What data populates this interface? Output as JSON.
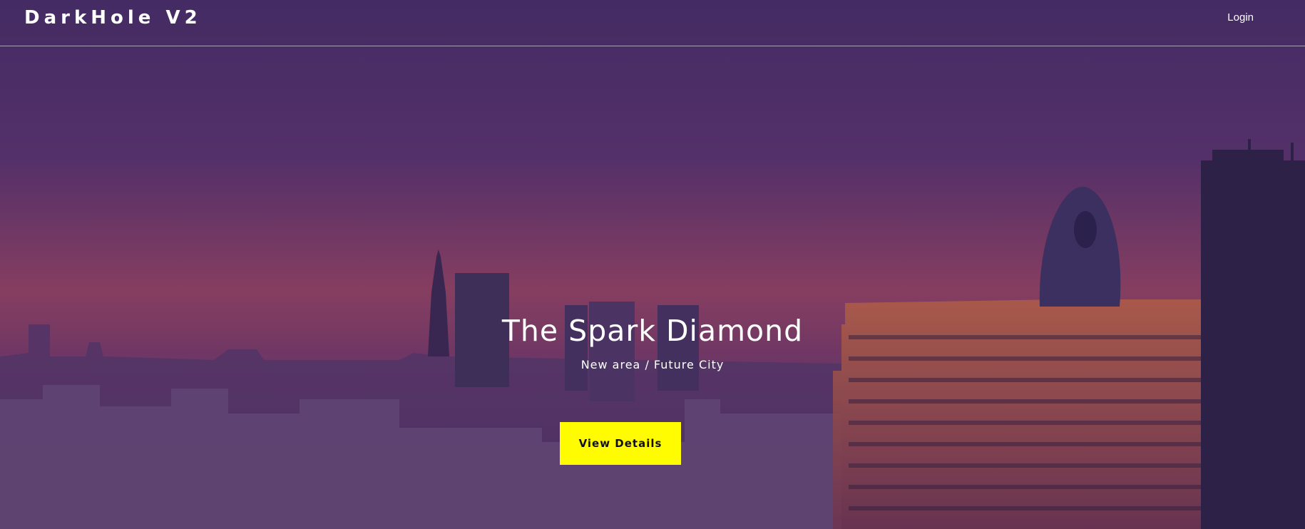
{
  "navbar": {
    "brand": "DarkHole V2",
    "login_label": "Login"
  },
  "hero": {
    "title": "The Spark Diamond",
    "subtitle": "New area / Future City",
    "cta_label": "View Details"
  },
  "colors": {
    "cta_background": "#fffb00",
    "overlay_tint": "#4a2f6c"
  }
}
